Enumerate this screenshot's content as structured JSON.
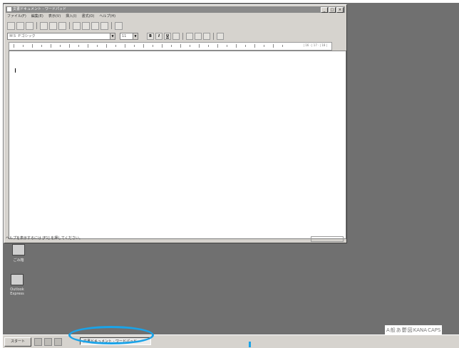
{
  "window": {
    "title": "文書ドキュメント - ワードパッド",
    "menus": [
      "ファイル(F)",
      "編集(E)",
      "表示(V)",
      "挿入(I)",
      "書式(O)",
      "ヘルプ(H)"
    ],
    "font_name": "ＭＳ Ｐゴシック",
    "font_size": "11",
    "style_labels": {
      "bold": "B",
      "italic": "I",
      "underline": "U"
    },
    "ruler_text": "| 16 · | 17 · | 18 |",
    "status_text": "ヘルプを表示するには [F1] を押してください。"
  },
  "desktop": {
    "icons": [
      {
        "label": "ごみ箱",
        "icon": "recycle-bin-icon"
      },
      {
        "label": "Outlook Express",
        "icon": "outlook-express-icon"
      }
    ]
  },
  "taskbar": {
    "start_label": "スタート",
    "active_task": "文書ドキュメント - ワードパッド",
    "ime_chars": [
      "A",
      "般",
      "あ",
      "鬱",
      "図",
      "KANA",
      "CAPS"
    ],
    "highlight_color": "#1aa3e8"
  }
}
